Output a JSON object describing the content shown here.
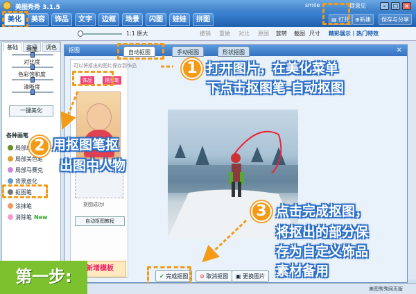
{
  "window": {
    "title": "美图秀秀 3.1.5",
    "user_label": "smile",
    "feedback": "提意见"
  },
  "menu": {
    "tabs": [
      "美化",
      "美容",
      "饰品",
      "文字",
      "边框",
      "场景",
      "闪图",
      "娃娃",
      "拼图"
    ],
    "open": "打开",
    "new": "新建",
    "save": "保存与分享"
  },
  "toolbar": {
    "zoom": "1:1 原大",
    "undo": "撤销",
    "redo": "重做",
    "compare": "对比",
    "bg": "原图",
    "rotate": "旋转",
    "crop": "截图",
    "size": "尺寸",
    "hot_label": "精彩展示丨热门特效"
  },
  "left_panel": {
    "tabs": [
      "基础",
      "高级",
      "调色"
    ],
    "sliders": [
      {
        "label": "亮度",
        "value": 0.5
      },
      {
        "label": "对比度",
        "value": 0.5
      },
      {
        "label": "色彩饱和度",
        "value": 0.5
      },
      {
        "label": "清晰度",
        "value": 0.5
      }
    ],
    "one_click": "一键美化",
    "section": "各种画笔",
    "tools": [
      "局部磨皮",
      "局部美色笔",
      "局部马赛克",
      "背景虚化",
      "抠图笔",
      "涂抹笔",
      "消除笔"
    ],
    "new_badge": "New"
  },
  "dialog": {
    "title": "抠图",
    "tabs": [
      "自动抠图",
      "手动抠图",
      "形状抠图"
    ],
    "hint": "可以将抠出的图片保存到饰品",
    "mini_tabs": [
      "饰品",
      "抠图笔"
    ],
    "done_caption": "抠图成功!",
    "tutorial": "自动抠图教程",
    "promo": "新增模板",
    "buttons": [
      "完成抠图",
      "取消抠图",
      "更换图片"
    ]
  },
  "annotations": {
    "n1": "1",
    "t1a": "打开图片，在美化菜单",
    "t1b": "下点击抠图笔-自动抠图",
    "n2": "2",
    "t2a": "用抠图笔抠",
    "t2b": "出图中人物",
    "n3": "3",
    "t3a": "点击完成抠图，",
    "t3b": "将抠出的部分保",
    "t3c": "存为自定义饰品",
    "t3d": "素材备用",
    "step": "第一步:"
  },
  "status": {
    "text": "美图秀秀网页版"
  },
  "colors": {
    "accent": "#f39a16",
    "menu": "#1f5fae",
    "step": "#7bc22e"
  }
}
